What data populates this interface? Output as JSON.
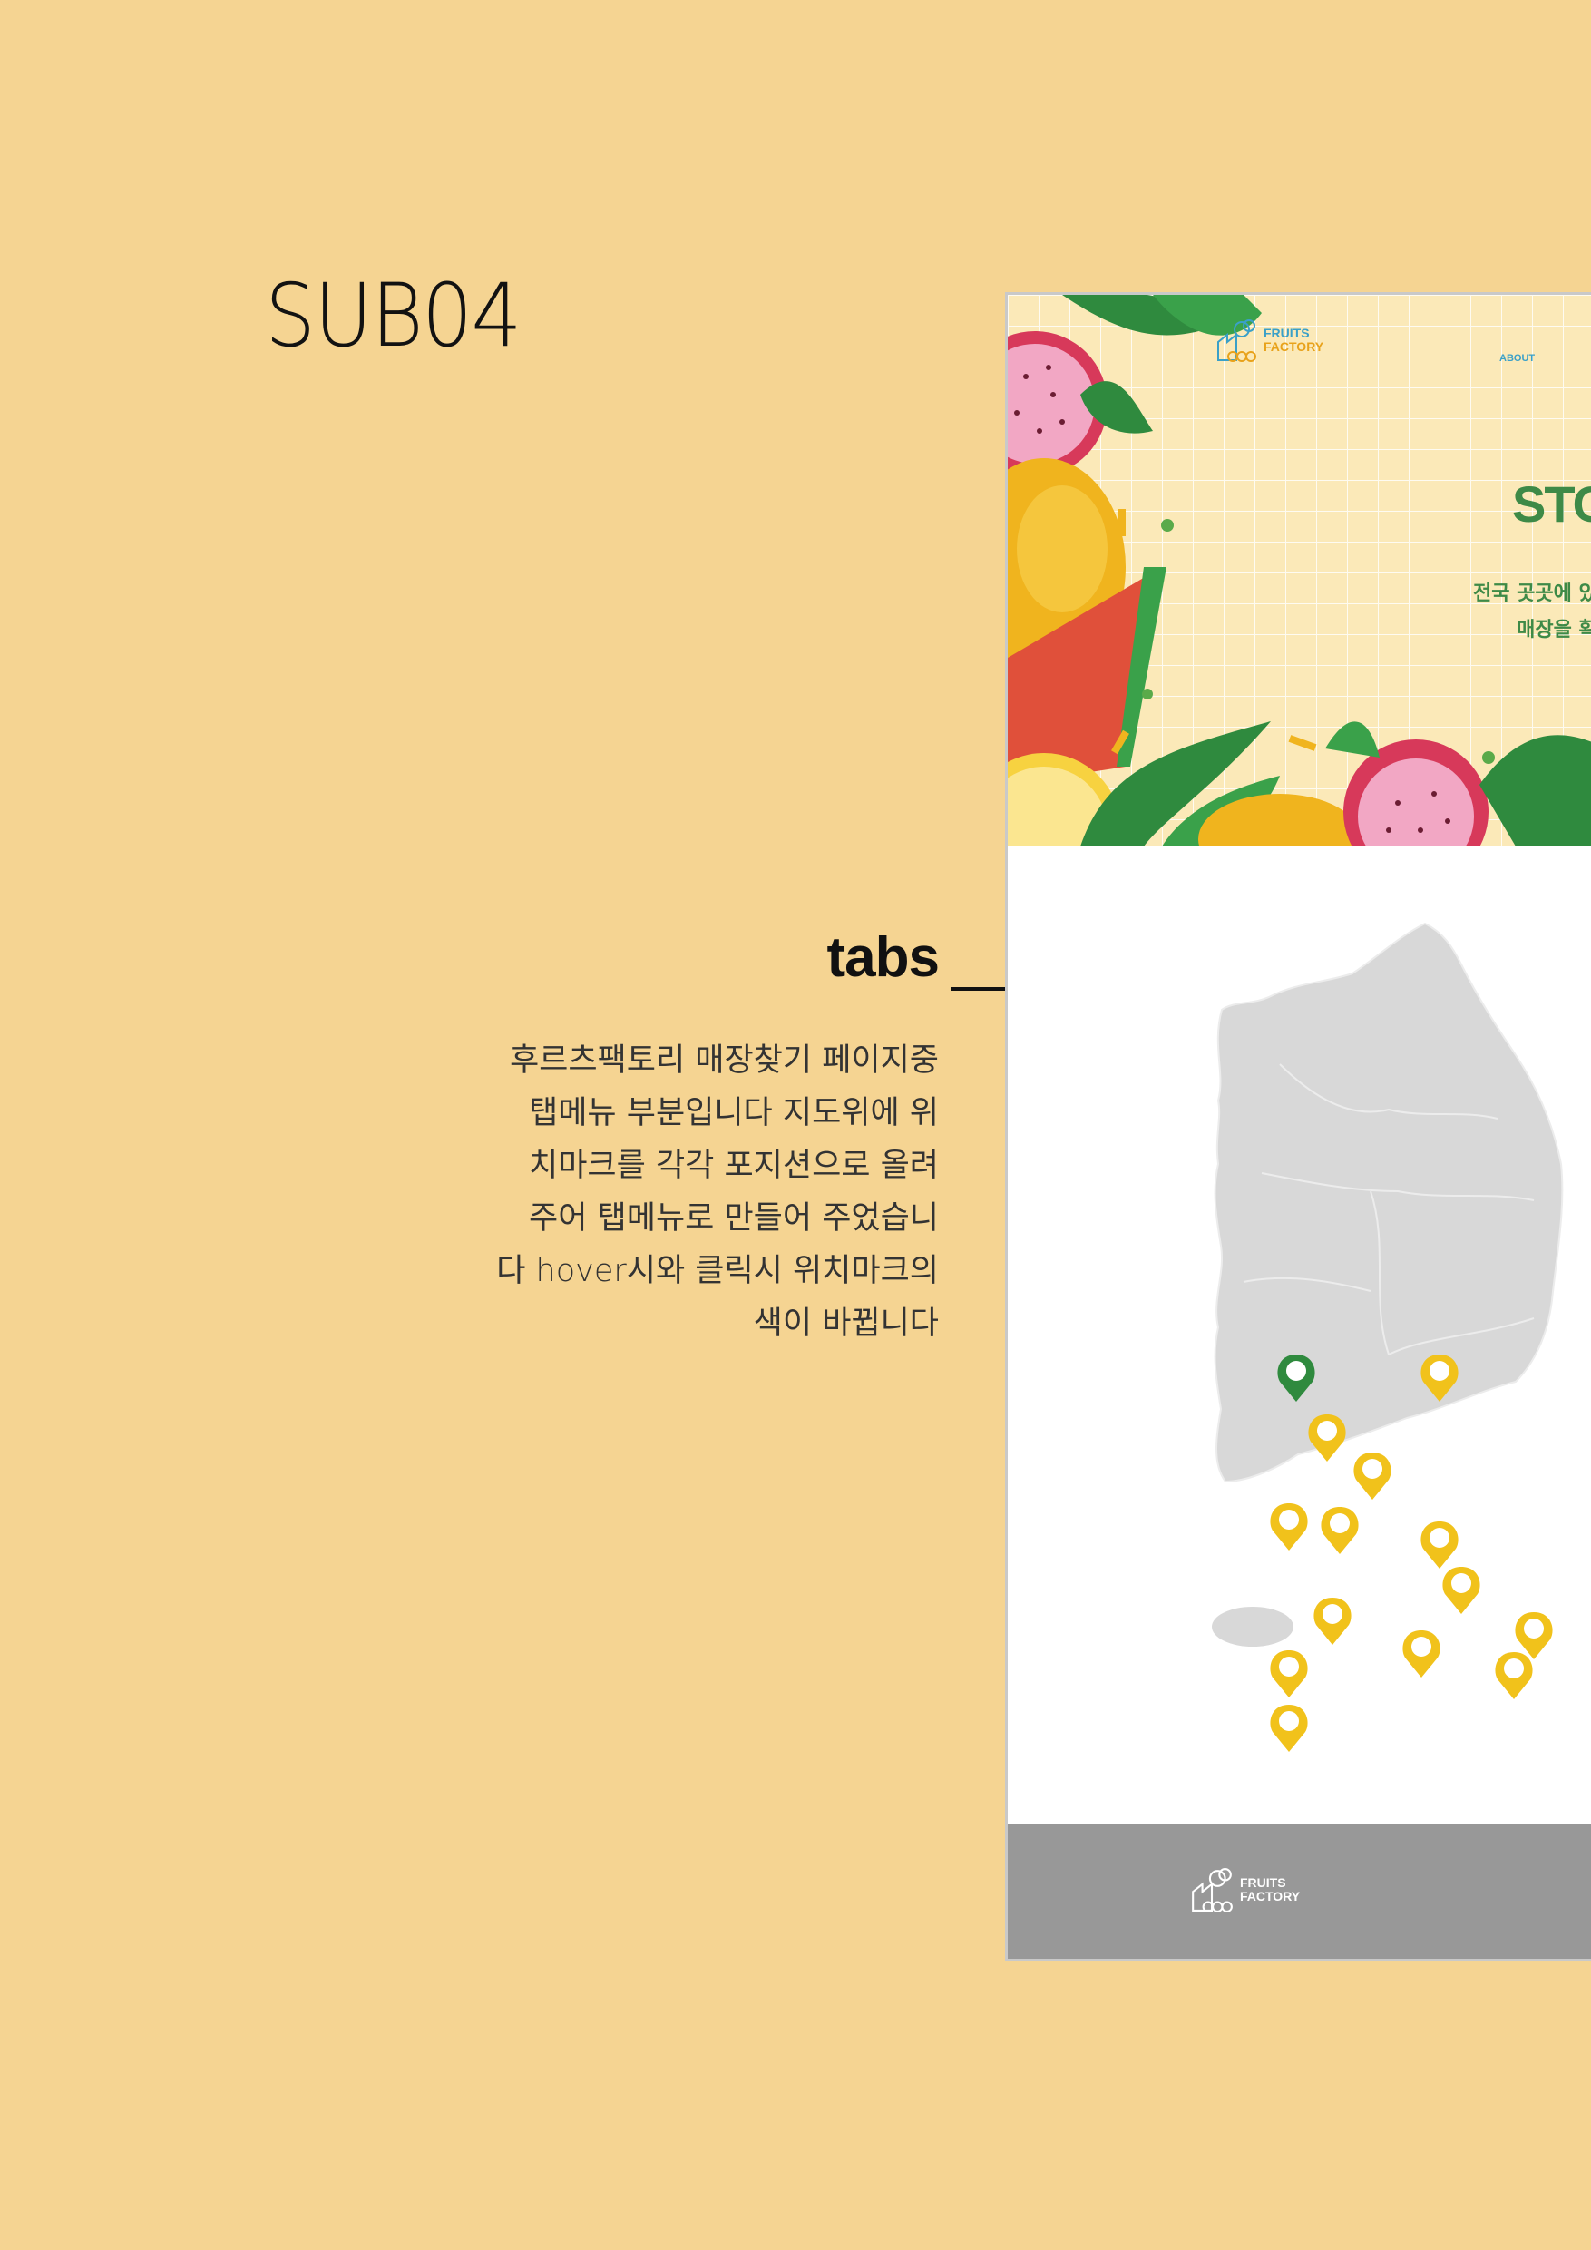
{
  "page": {
    "title": "SUB04",
    "section_label": "tabs",
    "description_lines": [
      "후르츠팩토리 매장찾기 페이지중",
      "탭메뉴 부분입니다 지도위에 위",
      "치마크를 각각 포지션으로 올려",
      "주어 탭메뉴로 만들어 주었습니",
      "다 hover시와 클릭시 위치마크의",
      "색이 바뀝니다"
    ]
  },
  "screenshot": {
    "logo": {
      "line1": "FRUITS",
      "line2": "FACTORY"
    },
    "nav": {
      "about": "ABOUT"
    },
    "hero": {
      "title": "STO",
      "subtitle_lines": [
        "전국 곳곳에 있는",
        "매장을 확인"
      ]
    },
    "map": {
      "markers": [
        {
          "state": "active",
          "icon": "map-pin-icon"
        },
        {
          "state": "default",
          "icon": "map-pin-icon"
        }
      ]
    },
    "footer": {
      "logo_line1": "FRUITS",
      "logo_line2": "FACTORY"
    }
  },
  "colors": {
    "background": "#f5d492",
    "marker_default": "#f1c21b",
    "marker_active": "#2f8a3e",
    "map_land": "#d8d8d8",
    "footer": "#989898",
    "hero_green": "#3e8a47"
  }
}
